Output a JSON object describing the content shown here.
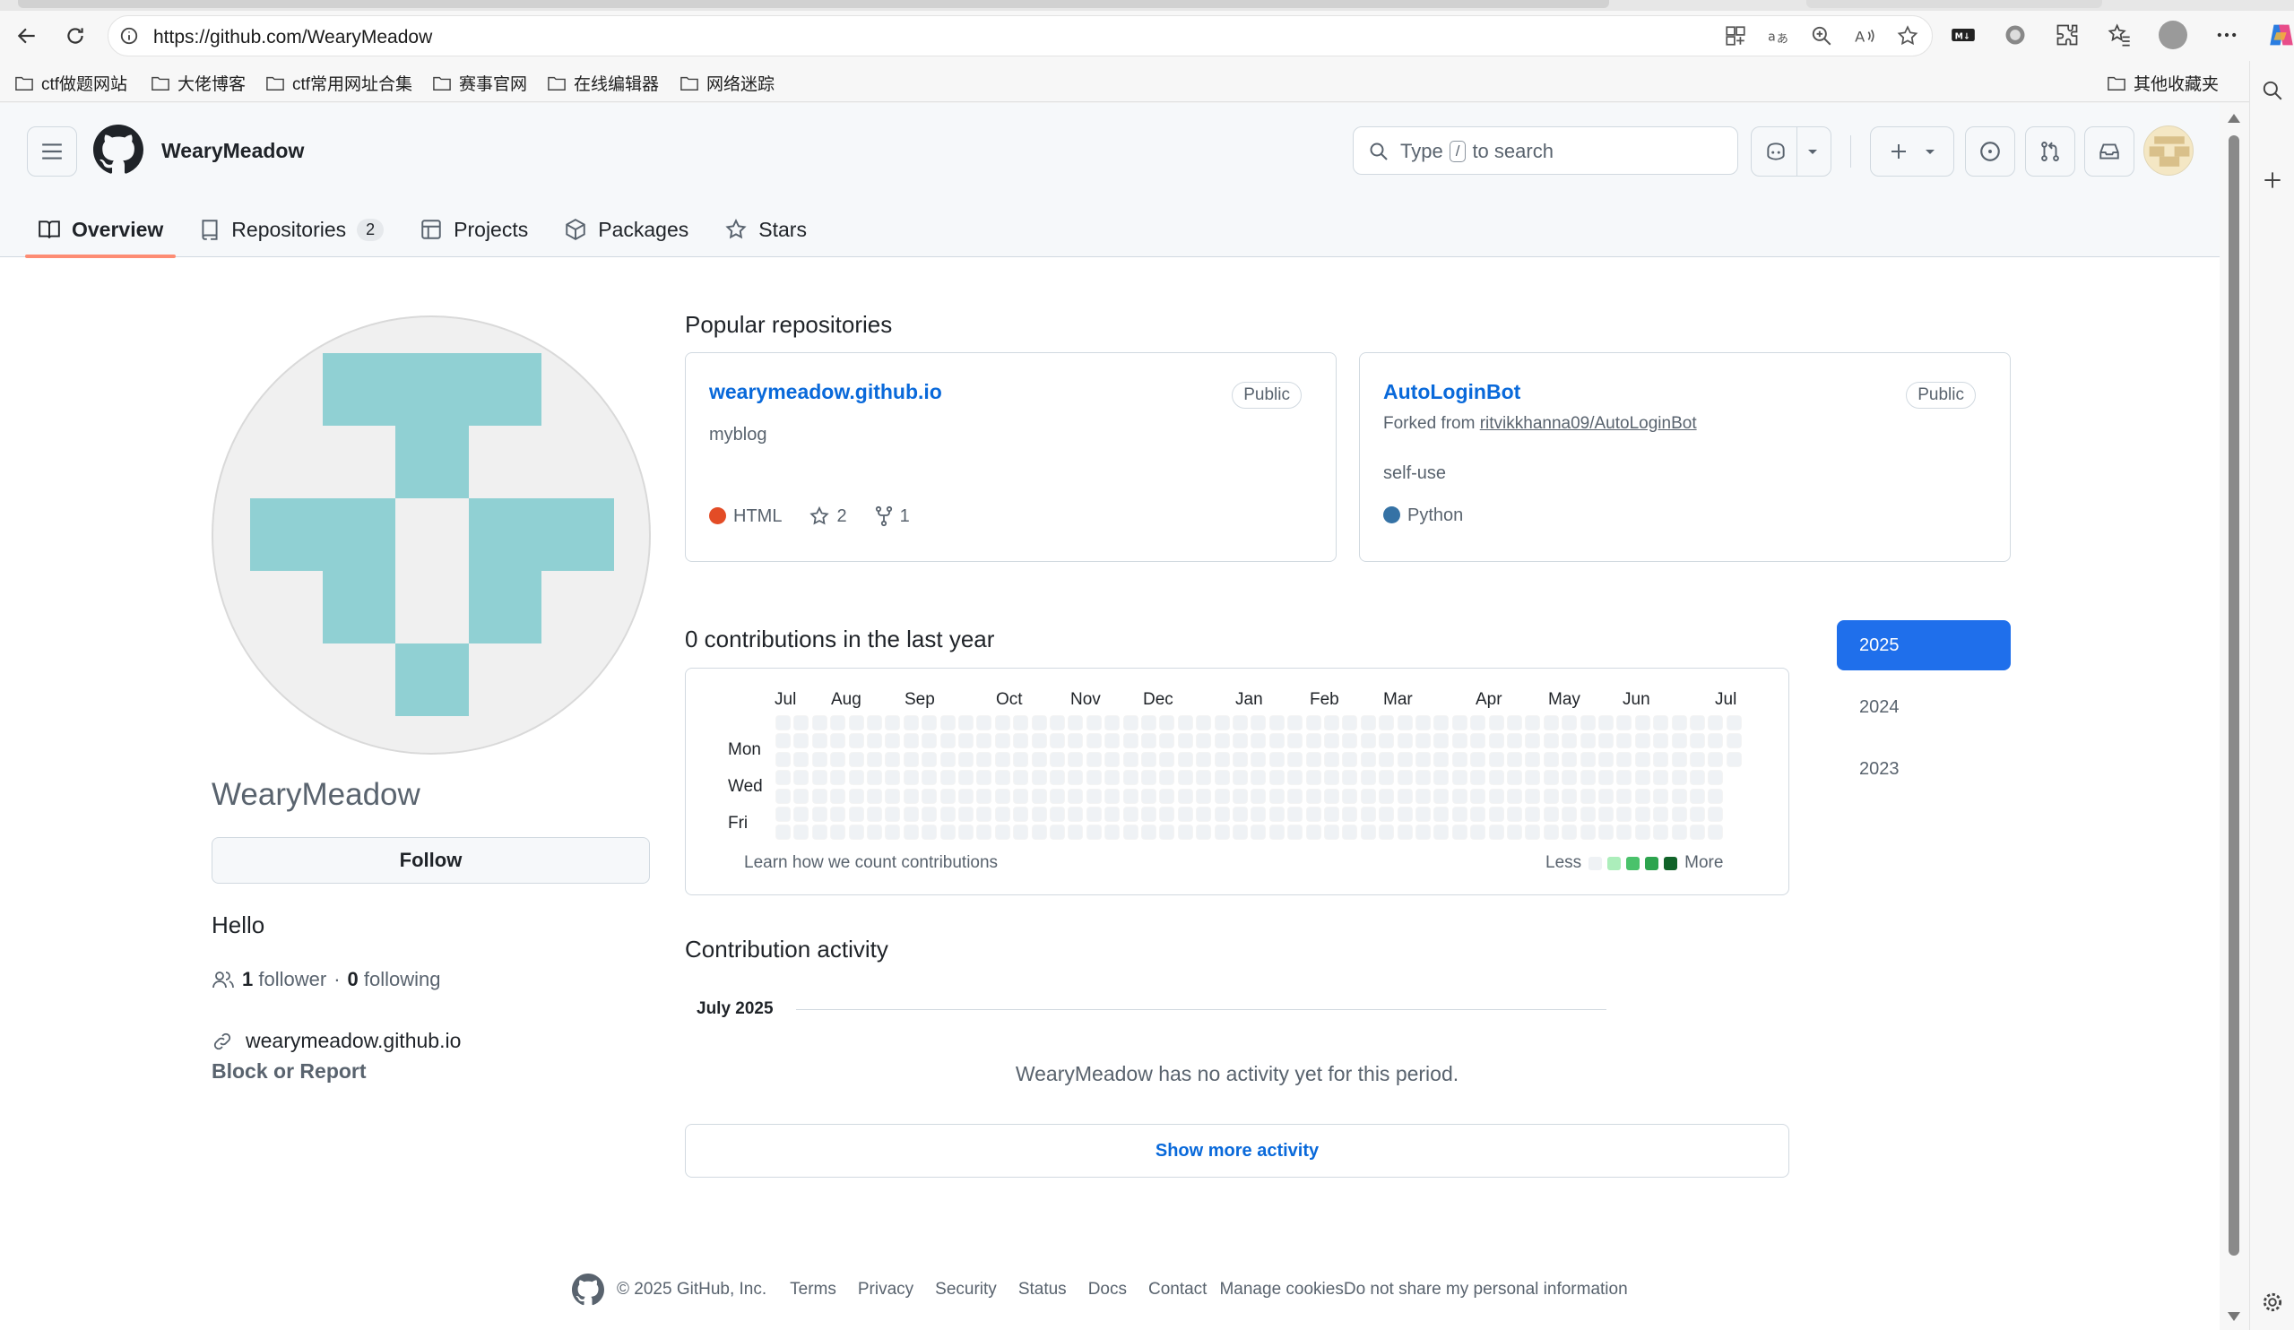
{
  "browser": {
    "url": "https://github.com/WearyMeadow",
    "bookmarks": [
      "ctf做题网站",
      "大佬博客",
      "ctf常用网址合集",
      "赛事官网",
      "在线编辑器",
      "网络迷踪"
    ],
    "other_bookmarks": "其他收藏夹"
  },
  "header": {
    "username": "WearyMeadow",
    "search_prefix": "Type",
    "search_key": "/",
    "search_suffix": "to search"
  },
  "tabs": [
    {
      "label": "Overview",
      "icon": "book-icon"
    },
    {
      "label": "Repositories",
      "count": "2",
      "icon": "repo-icon"
    },
    {
      "label": "Projects",
      "icon": "table-icon"
    },
    {
      "label": "Packages",
      "icon": "package-icon"
    },
    {
      "label": "Stars",
      "icon": "star-icon"
    }
  ],
  "profile": {
    "name": "WearyMeadow",
    "follow_label": "Follow",
    "bio": "Hello",
    "followers_count": "1",
    "followers_label": "follower",
    "separator": "·",
    "following_count": "0",
    "following_label": "following",
    "website": "wearymeadow.github.io",
    "block_label": "Block or Report"
  },
  "popular": {
    "title": "Popular repositories",
    "repos": [
      {
        "name": "wearymeadow.github.io",
        "visibility": "Public",
        "description": "myblog",
        "language": "HTML",
        "language_color": "#e34c26",
        "stars": "2",
        "forks": "1"
      },
      {
        "name": "AutoLoginBot",
        "visibility": "Public",
        "forked_prefix": "Forked from",
        "forked_from": "ritvikkhanna09/AutoLoginBot",
        "description": "self-use",
        "language": "Python",
        "language_color": "#3572A5"
      }
    ]
  },
  "contributions": {
    "title": "0 contributions in the last year",
    "months": [
      "Jul",
      "Aug",
      "Sep",
      "Oct",
      "Nov",
      "Dec",
      "Jan",
      "Feb",
      "Mar",
      "Apr",
      "May",
      "Jun",
      "Jul"
    ],
    "days": [
      "Mon",
      "Wed",
      "Fri"
    ],
    "learn_link": "Learn how we count contributions",
    "legend_less": "Less",
    "legend_more": "More",
    "legend_colors": [
      "#eff2f5",
      "#aceebb",
      "#4ac26b",
      "#2da44e",
      "#116329"
    ],
    "total": 0
  },
  "years": [
    "2025",
    "2024",
    "2023"
  ],
  "activity": {
    "title": "Contribution activity",
    "month": "July 2025",
    "empty": "WearyMeadow has no activity yet for this period.",
    "show_more": "Show more activity"
  },
  "footer": {
    "copyright": "© 2025 GitHub, Inc.",
    "links": [
      "Terms",
      "Privacy",
      "Security",
      "Status",
      "Docs",
      "Contact",
      "Manage cookies",
      "Do not share my personal information"
    ]
  },
  "colors": {
    "accent": "#0969da",
    "tab_underline": "#fd8c73",
    "year_active": "#1f6feb",
    "avatar_identicon": "#90d0d3"
  }
}
